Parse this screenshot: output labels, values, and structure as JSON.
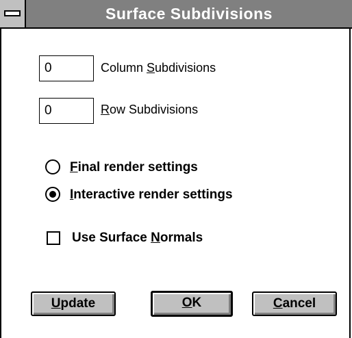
{
  "window": {
    "title": "Surface Subdivisions"
  },
  "fields": {
    "column": {
      "value": "0",
      "label_pre": "Column ",
      "label_key": "S",
      "label_post": "ubdivisions"
    },
    "row": {
      "value": "0",
      "label_pre": "",
      "label_key": "R",
      "label_post": "ow Subdivisions"
    }
  },
  "render_mode": {
    "selected": "interactive",
    "final": {
      "label_pre": "",
      "label_key": "F",
      "label_post": "inal render settings"
    },
    "interactive": {
      "label_pre": "",
      "label_key": "I",
      "label_post": "nteractive render settings"
    }
  },
  "surface_normals": {
    "checked": false,
    "label_pre": "Use Surface ",
    "label_key": "N",
    "label_post": "ormals"
  },
  "buttons": {
    "update": {
      "key": "U",
      "rest": "pdate"
    },
    "ok": {
      "key": "O",
      "rest": "K"
    },
    "cancel": {
      "key": "C",
      "rest": "ancel"
    }
  }
}
